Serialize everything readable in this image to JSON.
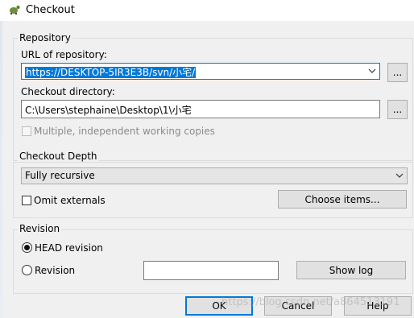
{
  "window": {
    "title": "Checkout"
  },
  "repository": {
    "group_label": "Repository",
    "url_label": "URL of repository:",
    "url_value": "https://DESKTOP-5IR3E3B/svn/小宅/",
    "url_browse_label": "...",
    "dir_label": "Checkout directory:",
    "dir_value": "C:\\Users\\stephaine\\Desktop\\1\\小宅",
    "dir_browse_label": "...",
    "multiple_copies_label": "Multiple, independent working copies",
    "multiple_copies_checked": false
  },
  "depth": {
    "group_label": "Checkout Depth",
    "selected": "Fully recursive",
    "omit_externals_label": "Omit externals",
    "omit_externals_checked": false,
    "choose_items_label": "Choose items..."
  },
  "revision": {
    "group_label": "Revision",
    "head_label": "HEAD revision",
    "head_checked": true,
    "revision_label": "Revision",
    "revision_checked": false,
    "revision_value": "",
    "show_log_label": "Show log"
  },
  "buttons": {
    "ok": "OK",
    "cancel": "Cancel",
    "help": "Help"
  },
  "watermark": "https://blog.csdn.net/a864513191",
  "colors": {
    "accent": "#0078d7",
    "client_bg": "#f0f0f0"
  },
  "icons": {
    "app": "tortoise-svn-icon",
    "dropdown": "chevron-down-icon"
  }
}
